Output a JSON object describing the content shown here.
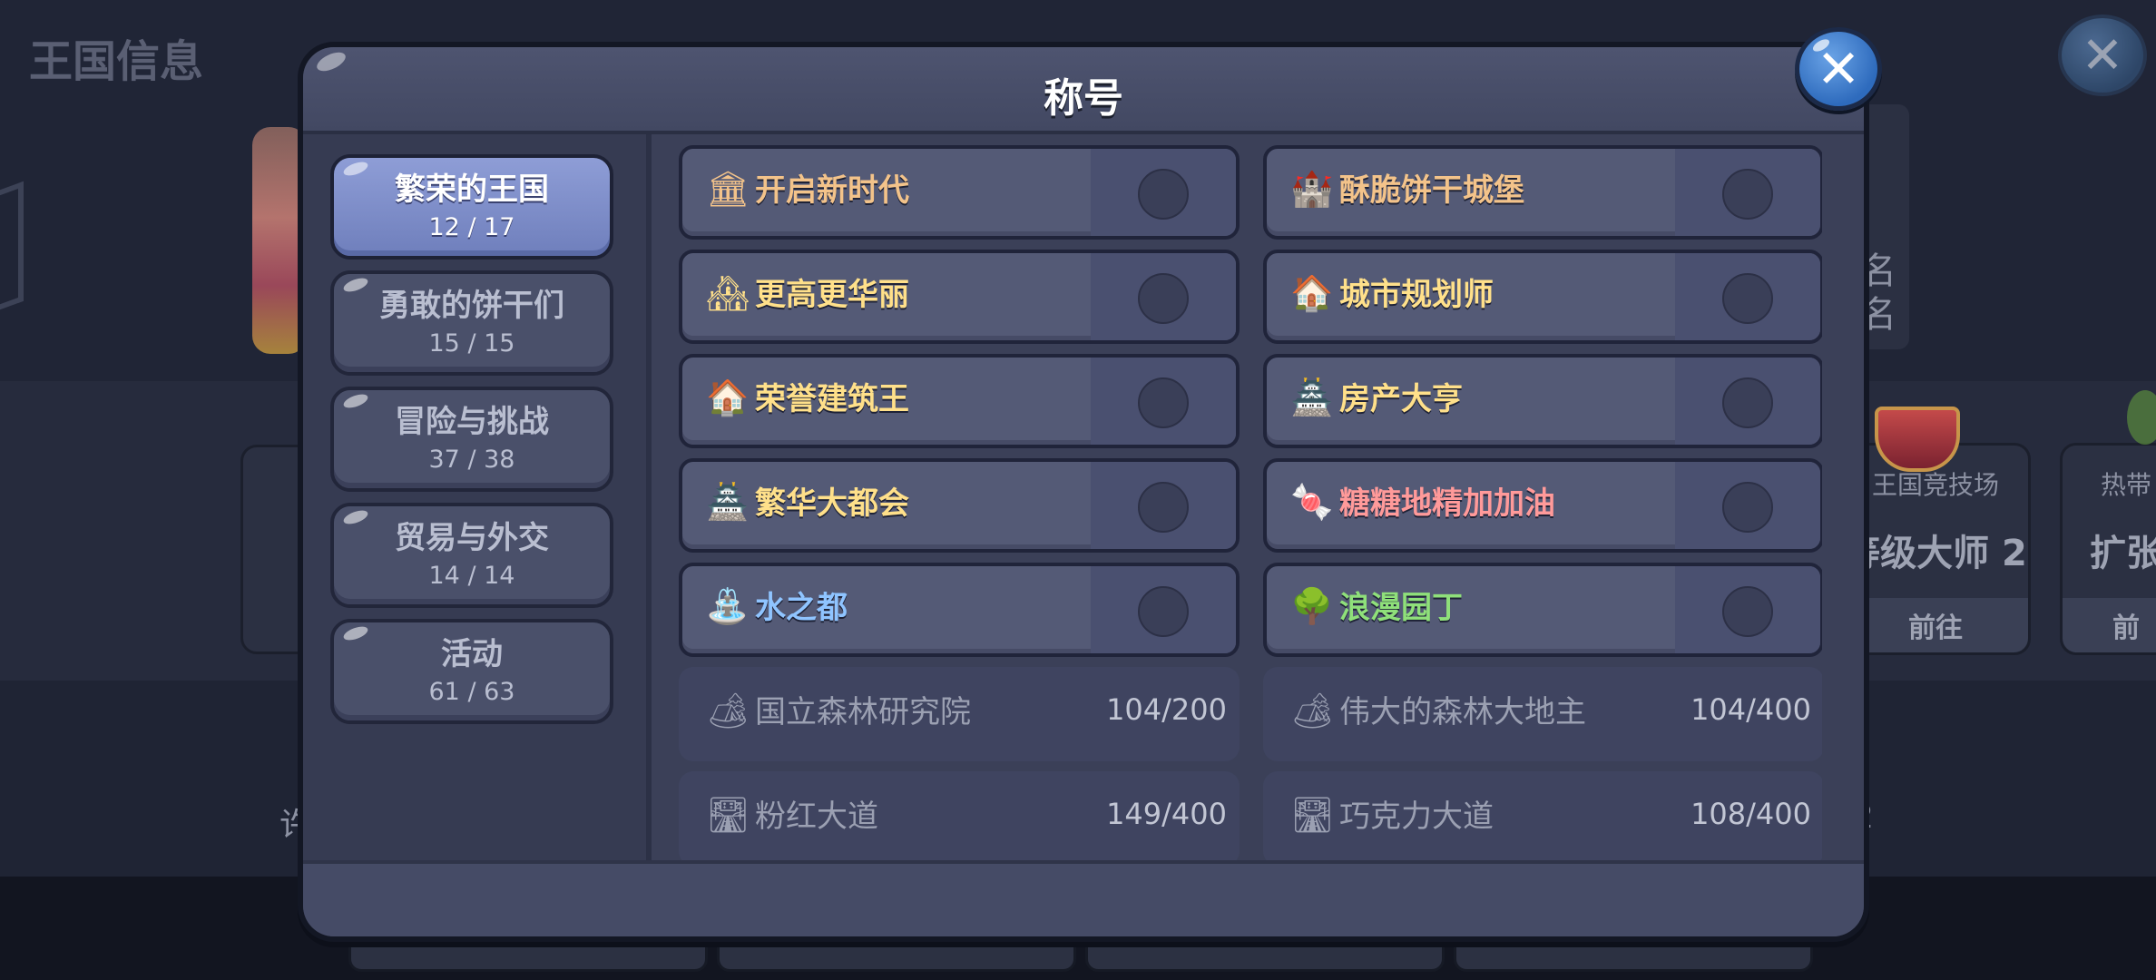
{
  "background": {
    "page_title": "王国信息",
    "arena_label": "王国竞技场",
    "arena_rank": "等级大师 2",
    "arena_go": "前往",
    "tropical_label": "热带",
    "tropical_value": "扩张",
    "tropical_go": "前",
    "side_glyphs": "名\n名",
    "left_glyph": "7",
    "low_left": "许",
    "low_right": "2"
  },
  "modal": {
    "title": "称号",
    "categories": [
      {
        "name": "繁荣的王国",
        "count": "12 / 17",
        "active": true
      },
      {
        "name": "勇敢的饼干们",
        "count": "15 / 15"
      },
      {
        "name": "冒险与挑战",
        "count": "37 / 38"
      },
      {
        "name": "贸易与外交",
        "count": "14 / 14"
      },
      {
        "name": "活动",
        "count": "61 / 63"
      }
    ],
    "titles": [
      {
        "name": "开启新时代",
        "icon": "🏛",
        "color": "#f3c38a",
        "state": "owned"
      },
      {
        "name": "酥脆饼干城堡",
        "icon": "🏰",
        "color": "#f3c38a",
        "state": "owned"
      },
      {
        "name": "更高更华丽",
        "icon": "🏘",
        "color": "#ffe08a",
        "state": "owned"
      },
      {
        "name": "城市规划师",
        "icon": "🏠",
        "color": "#ffe08a",
        "state": "owned"
      },
      {
        "name": "荣誉建筑王",
        "icon": "🏠",
        "color": "#ffe08a",
        "state": "owned"
      },
      {
        "name": "房产大亨",
        "icon": "🏯",
        "color": "#ffe08a",
        "state": "owned"
      },
      {
        "name": "繁华大都会",
        "icon": "🏯",
        "color": "#ffe08a",
        "state": "owned"
      },
      {
        "name": "糖糖地精加加油",
        "icon": "🍬",
        "color": "#ff9a9a",
        "state": "owned"
      },
      {
        "name": "水之都",
        "icon": "⛲",
        "color": "#8fc4ff",
        "state": "owned"
      },
      {
        "name": "浪漫园丁",
        "icon": "🌳",
        "color": "#8fe07a",
        "state": "owned"
      },
      {
        "name": "国立森林研究院",
        "icon": "🏕",
        "color": "#9ba0b2",
        "state": "locked",
        "progress": "104/200"
      },
      {
        "name": "伟大的森林大地主",
        "icon": "🏕",
        "color": "#9ba0b2",
        "state": "locked",
        "progress": "104/400"
      },
      {
        "name": "粉红大道",
        "icon": "🛣",
        "color": "#9ba0b2",
        "state": "locked",
        "progress": "149/400"
      },
      {
        "name": "巧克力大道",
        "icon": "🛣",
        "color": "#9ba0b2",
        "state": "locked",
        "progress": "108/400"
      }
    ]
  }
}
